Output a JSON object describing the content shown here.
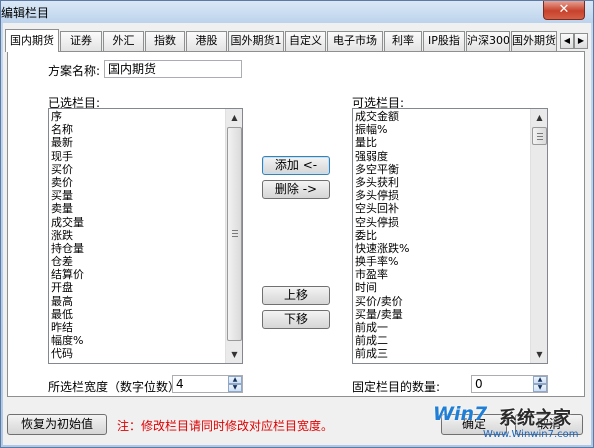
{
  "window": {
    "title": "编辑栏目",
    "close_glyph": "✕"
  },
  "tabs": [
    {
      "label": "国内期货",
      "active": true
    },
    {
      "label": "证券"
    },
    {
      "label": "外汇"
    },
    {
      "label": "指数"
    },
    {
      "label": "港股"
    },
    {
      "label": "国外期货1"
    },
    {
      "label": "自定义"
    },
    {
      "label": "电子市场"
    },
    {
      "label": "利率"
    },
    {
      "label": "IP股指"
    },
    {
      "label": "沪深300"
    },
    {
      "label": "国外期货"
    }
  ],
  "tab_scroll": {
    "left": "◀",
    "right": "▶"
  },
  "scheme": {
    "label": "方案名称:",
    "value": "国内期货"
  },
  "selected": {
    "label": "已选栏目:",
    "items": [
      "序",
      "名称",
      "最新",
      "现手",
      "买价",
      "卖价",
      "买量",
      "卖量",
      "成交量",
      "涨跌",
      "持仓量",
      "仓差",
      "结算价",
      "开盘",
      "最高",
      "最低",
      "昨结",
      "幅度%",
      "代码"
    ]
  },
  "available": {
    "label": "可选栏目:",
    "items": [
      "成交金额",
      "振幅%",
      "量比",
      "强弱度",
      "多空平衡",
      "多头获利",
      "多头停损",
      "空头回补",
      "空头停损",
      "委比",
      "快速涨跌%",
      "换手率%",
      "市盈率",
      "时间",
      "买价/卖价",
      "买量/卖量",
      "前成一",
      "前成二",
      "前成三"
    ]
  },
  "buttons": {
    "add": "添加 <-",
    "remove": "删除 ->",
    "up": "上移",
    "down": "下移",
    "reset": "恢复为初始值",
    "ok": "确定",
    "cancel": "取消"
  },
  "width_field": {
    "label": "所选栏宽度（数字位数）:",
    "value": "4"
  },
  "fixed_field": {
    "label": "固定栏目的数量:",
    "value": "0"
  },
  "note": "注：修改栏目请同时修改对应栏目宽度。",
  "scroll_arrows": {
    "up": "▲",
    "down": "▼"
  },
  "spin_arrows": {
    "up": "▲",
    "down": "▼"
  },
  "watermark": {
    "logo": "Win7",
    "site": "系统之家",
    "url": "Www.Winwin7.com"
  }
}
